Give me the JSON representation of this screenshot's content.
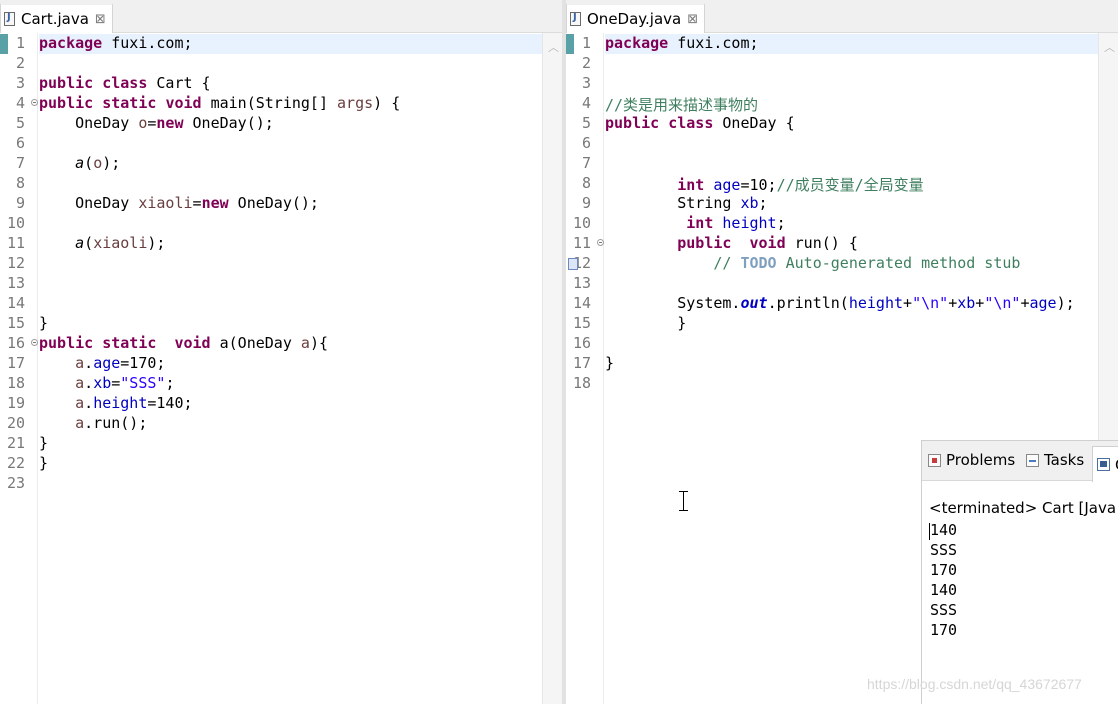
{
  "left_editor": {
    "tab_label": "Cart.java",
    "tab_close": "⊠",
    "lines": [
      [
        {
          "t": "package",
          "c": "kw"
        },
        {
          "t": " fuxi.com;"
        }
      ],
      [],
      [
        {
          "t": "public",
          "c": "kw"
        },
        {
          "t": " "
        },
        {
          "t": "class",
          "c": "kw"
        },
        {
          "t": " Cart {"
        }
      ],
      [
        {
          "t": "public",
          "c": "kw"
        },
        {
          "t": " "
        },
        {
          "t": "static",
          "c": "kw"
        },
        {
          "t": " "
        },
        {
          "t": "void",
          "c": "kw"
        },
        {
          "t": " main(String[] "
        },
        {
          "t": "args",
          "c": "var"
        },
        {
          "t": ") {"
        }
      ],
      [
        {
          "t": "    OneDay "
        },
        {
          "t": "o",
          "c": "var"
        },
        {
          "t": "="
        },
        {
          "t": "new",
          "c": "kw"
        },
        {
          "t": " OneDay();"
        }
      ],
      [],
      [
        {
          "t": "    "
        },
        {
          "t": "a",
          "c": "stat"
        },
        {
          "t": "("
        },
        {
          "t": "o",
          "c": "var"
        },
        {
          "t": ");"
        }
      ],
      [],
      [
        {
          "t": "    OneDay "
        },
        {
          "t": "xiaoli",
          "c": "var"
        },
        {
          "t": "="
        },
        {
          "t": "new",
          "c": "kw"
        },
        {
          "t": " OneDay();"
        }
      ],
      [],
      [
        {
          "t": "    "
        },
        {
          "t": "a",
          "c": "stat"
        },
        {
          "t": "("
        },
        {
          "t": "xiaoli",
          "c": "var"
        },
        {
          "t": ");"
        }
      ],
      [],
      [],
      [],
      [
        {
          "t": "}"
        }
      ],
      [
        {
          "t": "public",
          "c": "kw"
        },
        {
          "t": " "
        },
        {
          "t": "static",
          "c": "kw"
        },
        {
          "t": "  "
        },
        {
          "t": "void",
          "c": "kw"
        },
        {
          "t": " a(OneDay "
        },
        {
          "t": "a",
          "c": "var"
        },
        {
          "t": "){"
        }
      ],
      [
        {
          "t": "    "
        },
        {
          "t": "a",
          "c": "var"
        },
        {
          "t": "."
        },
        {
          "t": "age",
          "c": "fld"
        },
        {
          "t": "=170;"
        }
      ],
      [
        {
          "t": "    "
        },
        {
          "t": "a",
          "c": "var"
        },
        {
          "t": "."
        },
        {
          "t": "xb",
          "c": "fld"
        },
        {
          "t": "="
        },
        {
          "t": "\"SSS\"",
          "c": "str"
        },
        {
          "t": ";"
        }
      ],
      [
        {
          "t": "    "
        },
        {
          "t": "a",
          "c": "var"
        },
        {
          "t": "."
        },
        {
          "t": "height",
          "c": "fld"
        },
        {
          "t": "=140;"
        }
      ],
      [
        {
          "t": "    "
        },
        {
          "t": "a",
          "c": "var"
        },
        {
          "t": ".run();"
        }
      ],
      [
        {
          "t": "}"
        }
      ],
      [
        {
          "t": "}"
        }
      ],
      []
    ]
  },
  "right_editor": {
    "tab_label": "OneDay.java",
    "tab_close": "⊠",
    "lines": [
      [
        {
          "t": "package",
          "c": "kw"
        },
        {
          "t": " fuxi.com;"
        }
      ],
      [],
      [],
      [
        {
          "t": "//类是用来描述事物的",
          "c": "cm"
        }
      ],
      [
        {
          "t": "public",
          "c": "kw"
        },
        {
          "t": " "
        },
        {
          "t": "class",
          "c": "kw"
        },
        {
          "t": " OneDay {"
        }
      ],
      [],
      [],
      [
        {
          "t": "        "
        },
        {
          "t": "int",
          "c": "kw"
        },
        {
          "t": " "
        },
        {
          "t": "age",
          "c": "fld"
        },
        {
          "t": "=10;"
        },
        {
          "t": "//成员变量/全局变量",
          "c": "cm"
        }
      ],
      [
        {
          "t": "        String "
        },
        {
          "t": "xb",
          "c": "fld"
        },
        {
          "t": ";"
        }
      ],
      [
        {
          "t": "         "
        },
        {
          "t": "int",
          "c": "kw"
        },
        {
          "t": " "
        },
        {
          "t": "height",
          "c": "fld"
        },
        {
          "t": ";"
        }
      ],
      [
        {
          "t": "        "
        },
        {
          "t": "public",
          "c": "kw"
        },
        {
          "t": "  "
        },
        {
          "t": "void",
          "c": "kw"
        },
        {
          "t": " run() {"
        }
      ],
      [
        {
          "t": "            "
        },
        {
          "t": "// ",
          "c": "cm"
        },
        {
          "t": "TODO",
          "c": "todo"
        },
        {
          "t": " Auto-generated method stub",
          "c": "cm"
        }
      ],
      [],
      [
        {
          "t": "        System."
        },
        {
          "t": "out",
          "c": "sfld"
        },
        {
          "t": ".println("
        },
        {
          "t": "height",
          "c": "fld"
        },
        {
          "t": "+"
        },
        {
          "t": "\"\\n\"",
          "c": "str"
        },
        {
          "t": "+"
        },
        {
          "t": "xb",
          "c": "fld"
        },
        {
          "t": "+"
        },
        {
          "t": "\"\\n\"",
          "c": "str"
        },
        {
          "t": "+"
        },
        {
          "t": "age",
          "c": "fld"
        },
        {
          "t": ");"
        }
      ],
      [
        {
          "t": "        }"
        }
      ],
      [],
      [
        {
          "t": "}"
        }
      ],
      []
    ]
  },
  "console": {
    "tab_problems": "Problems",
    "tab_tasks": "Tasks",
    "tab_console": "C",
    "header": "<terminated> Cart [Java A",
    "output": [
      "140",
      "SSS",
      "170",
      "140",
      "SSS",
      "170"
    ]
  },
  "watermark": "https://blog.csdn.net/qq_43672677"
}
